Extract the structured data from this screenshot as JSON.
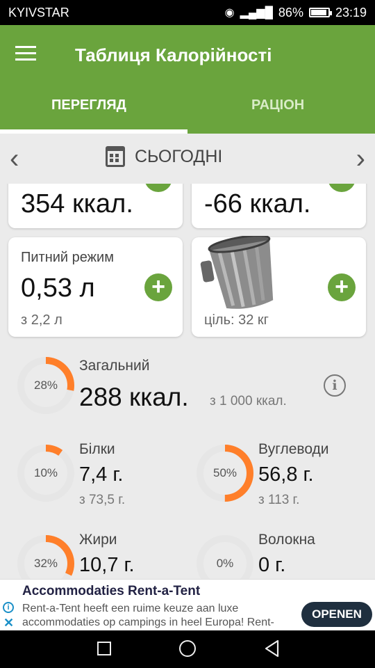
{
  "status_bar": {
    "carrier": "KYIVSTAR",
    "battery": "86%",
    "time": "23:19"
  },
  "app": {
    "title": "Таблиця Калорійності"
  },
  "tabs": [
    {
      "label": "ПЕРЕГЛЯД"
    },
    {
      "label": "РАЦІОН"
    }
  ],
  "date_nav": {
    "label": "СЬОГОДНІ"
  },
  "cards": {
    "top_left_value": "354 ккал.",
    "top_right_value": "-66 ккал.",
    "water": {
      "label": "Питний режим",
      "value": "0,53 л",
      "sub": "з 2,2 л"
    },
    "weight": {
      "sub": "ціль: 32 кг"
    }
  },
  "summary": {
    "total": {
      "label": "Загальний",
      "value": "288 ккал.",
      "of": "з 1 000 ккал.",
      "pct": "28%",
      "fraction": 0.28
    },
    "protein": {
      "label": "Білки",
      "value": "7,4 г.",
      "of": "з 73,5 г.",
      "pct": "10%",
      "fraction": 0.1
    },
    "carbs": {
      "label": "Вуглеводи",
      "value": "56,8 г.",
      "of": "з 113 г.",
      "pct": "50%",
      "fraction": 0.5
    },
    "fat": {
      "label": "Жири",
      "value": "10,7 г.",
      "pct": "32%",
      "fraction": 0.32
    },
    "fiber": {
      "label": "Волокна",
      "value": "0 г.",
      "pct": "0%",
      "fraction": 0
    }
  },
  "ad": {
    "title": "Accommodaties Rent-a-Tent",
    "text": "Rent-a-Tent heeft een ruime keuze aan luxe accommodaties op campings in heel Europa! Rent-",
    "button": "OPENEN"
  },
  "colors": {
    "primary": "#6aa43d",
    "ring": "#ff7f2a",
    "ring_track": "#e6e6e6"
  }
}
